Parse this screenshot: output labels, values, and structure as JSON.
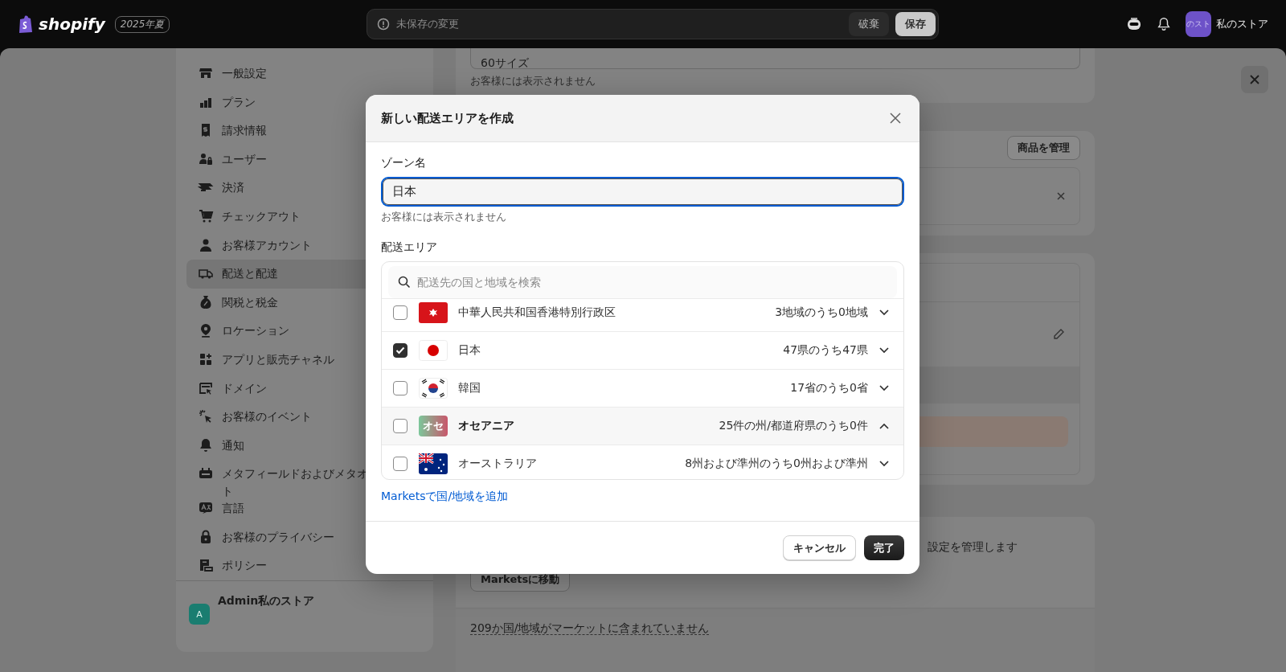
{
  "topbar": {
    "logo": "shopify",
    "edition": "2025年夏",
    "status": "未保存の変更",
    "discard": "破棄",
    "save": "保存",
    "store_avatar": "のスト",
    "store_name": "私のストア"
  },
  "sidebar": {
    "items": [
      {
        "label": "一般設定",
        "selected": false
      },
      {
        "label": "プラン",
        "selected": false
      },
      {
        "label": "請求情報",
        "selected": false
      },
      {
        "label": "ユーザー",
        "selected": false
      },
      {
        "label": "決済",
        "selected": false
      },
      {
        "label": "チェックアウト",
        "selected": false
      },
      {
        "label": "お客様アカウント",
        "selected": false
      },
      {
        "label": "配送と配達",
        "selected": true
      },
      {
        "label": "関税と税金",
        "selected": false
      },
      {
        "label": "ロケーション",
        "selected": false
      },
      {
        "label": "アプリと販売チャネル",
        "selected": false
      },
      {
        "label": "ドメイン",
        "selected": false
      },
      {
        "label": "お客様のイベント",
        "selected": false
      },
      {
        "label": "通知",
        "selected": false
      },
      {
        "label": "メタフィールドおよびメタオ",
        "label_line2": "ト",
        "selected": false
      },
      {
        "label": "言語",
        "selected": false
      },
      {
        "label": "お客様のプライバシー",
        "selected": false
      },
      {
        "label": "ポリシー",
        "selected": false
      }
    ],
    "account": {
      "avatar": "A",
      "name": "Admin私のストア"
    }
  },
  "background": {
    "size_value": "60サイズ",
    "size_help": "お客様には表示されません",
    "manage_products": "商品を管理",
    "markets_text": "設定を管理します",
    "markets_button": "Marketsに移動",
    "markets_footer": "209か国/地域がマーケットに含まれていません"
  },
  "modal": {
    "title": "新しい配送エリアを作成",
    "zone_label": "ゾーン名",
    "zone_value": "日本",
    "zone_help": "お客様には表示されません",
    "area_label": "配送エリア",
    "search_placeholder": "配送先の国と地域を検索",
    "rows": [
      {
        "kind": "country",
        "name": "中華人民共和国香港特別行政区",
        "count": "3地域のうち0地域",
        "checked": false,
        "expanded": false
      },
      {
        "kind": "country",
        "name": "日本",
        "count": "47県のうち47県",
        "checked": true,
        "expanded": false
      },
      {
        "kind": "country",
        "name": "韓国",
        "count": "17省のうち0省",
        "checked": false,
        "expanded": false
      },
      {
        "kind": "region",
        "badge": "オセ",
        "name": "オセアニア",
        "count": "25件の州/都道府県のうち0件",
        "checked": false,
        "expanded": true
      },
      {
        "kind": "country",
        "name": "オーストラリア",
        "count": "8州および準州のうち0州および準州",
        "checked": false,
        "expanded": false
      }
    ],
    "add_link": "Marketsで国/地域を追加",
    "cancel": "キャンセル",
    "done": "完了"
  }
}
